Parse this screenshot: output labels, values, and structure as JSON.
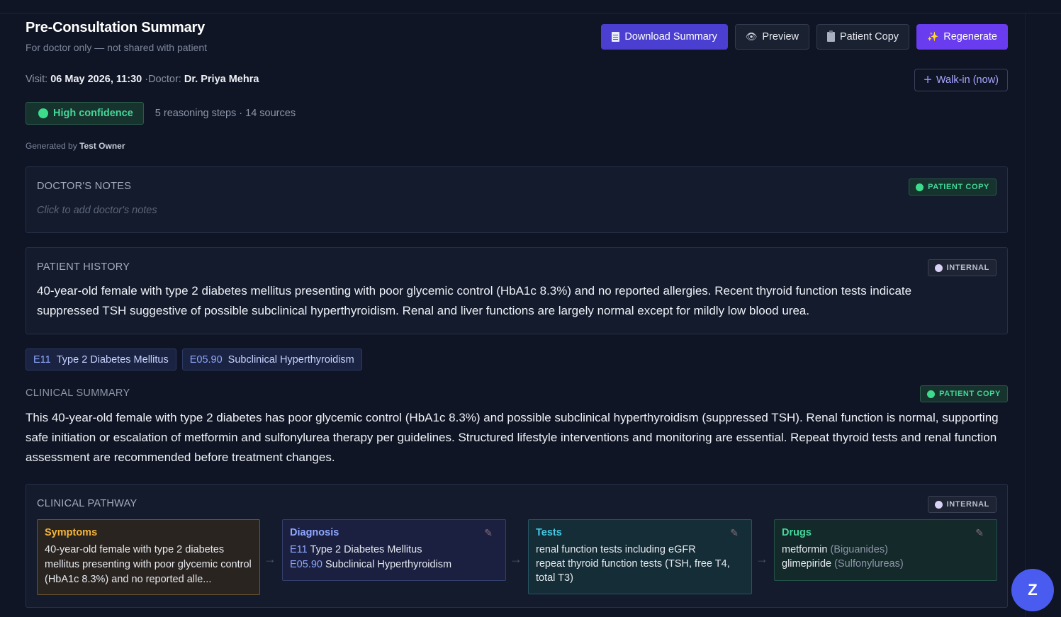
{
  "header": {
    "title": "Pre-Consultation Summary",
    "subtitle": "For doctor only — not shared with patient",
    "buttons": {
      "download": "Download Summary",
      "preview": "Preview",
      "patient_copy": "Patient Copy",
      "regenerate": "Regenerate"
    }
  },
  "visit": {
    "visit_label": "Visit:",
    "visit_value": "06 May 2026, 11:30",
    "sep": "·",
    "doctor_label": "Doctor:",
    "doctor_value": "Dr. Priya Mehra",
    "walkin": "Walk-in (now)"
  },
  "confidence": {
    "badge": "High confidence",
    "meta": "5 reasoning steps · 14 sources"
  },
  "generated": {
    "label": "Generated by",
    "by": "Test Owner"
  },
  "doctor_notes": {
    "label": "DOCTOR'S NOTES",
    "pill": "PATIENT COPY",
    "placeholder": "Click to add doctor's notes"
  },
  "patient_history": {
    "label": "PATIENT HISTORY",
    "pill": "INTERNAL",
    "text": "40-year-old female with type 2 diabetes mellitus presenting with poor glycemic control (HbA1c 8.3%) and no reported allergies. Recent thyroid function tests indicate suppressed TSH suggestive of possible subclinical hyperthyroidism. Renal and liver functions are largely normal except for mildly low blood urea."
  },
  "codes": [
    {
      "code": "E11",
      "name": "Type 2 Diabetes Mellitus"
    },
    {
      "code": "E05.90",
      "name": "Subclinical Hyperthyroidism"
    }
  ],
  "clinical_summary": {
    "label": "CLINICAL SUMMARY",
    "pill": "PATIENT COPY",
    "text": "This 40-year-old female with type 2 diabetes has poor glycemic control (HbA1c 8.3%) and possible subclinical hyperthyroidism (suppressed TSH). Renal function is normal, supporting safe initiation or escalation of metformin and sulfonylurea therapy per guidelines. Structured lifestyle interventions and monitoring are essential. Repeat thyroid tests and renal function assessment are recommended before treatment changes."
  },
  "clinical_pathway": {
    "label": "CLINICAL PATHWAY",
    "pill": "INTERNAL",
    "symptoms": {
      "title": "Symptoms",
      "text": "40-year-old female with type 2 diabetes mellitus presenting with poor glycemic control (HbA1c 8.3%) and no reported alle..."
    },
    "diagnosis": {
      "title": "Diagnosis",
      "items": [
        {
          "code": "E11",
          "name": "Type 2 Diabetes Mellitus"
        },
        {
          "code": "E05.90",
          "name": "Subclinical Hyperthyroidism"
        }
      ]
    },
    "tests": {
      "title": "Tests",
      "items": [
        "renal function tests including eGFR",
        "repeat thyroid function tests (TSH, free T4, total T3)"
      ]
    },
    "drugs": {
      "title": "Drugs",
      "items": [
        {
          "name": "metformin",
          "class": "(Biguanides)"
        },
        {
          "name": "glimepiride",
          "class": "(Sulfonylureas)"
        }
      ]
    }
  },
  "fab": {
    "label": "Z"
  },
  "colors": {
    "background": "#0f1524",
    "accent_primary": "#4b3fd1",
    "accent_violet": "#6a3cf0",
    "success": "#45d69a",
    "symptoms": "#f5b437",
    "diagnosis": "#8fa7ff",
    "tests": "#45c8e6"
  }
}
